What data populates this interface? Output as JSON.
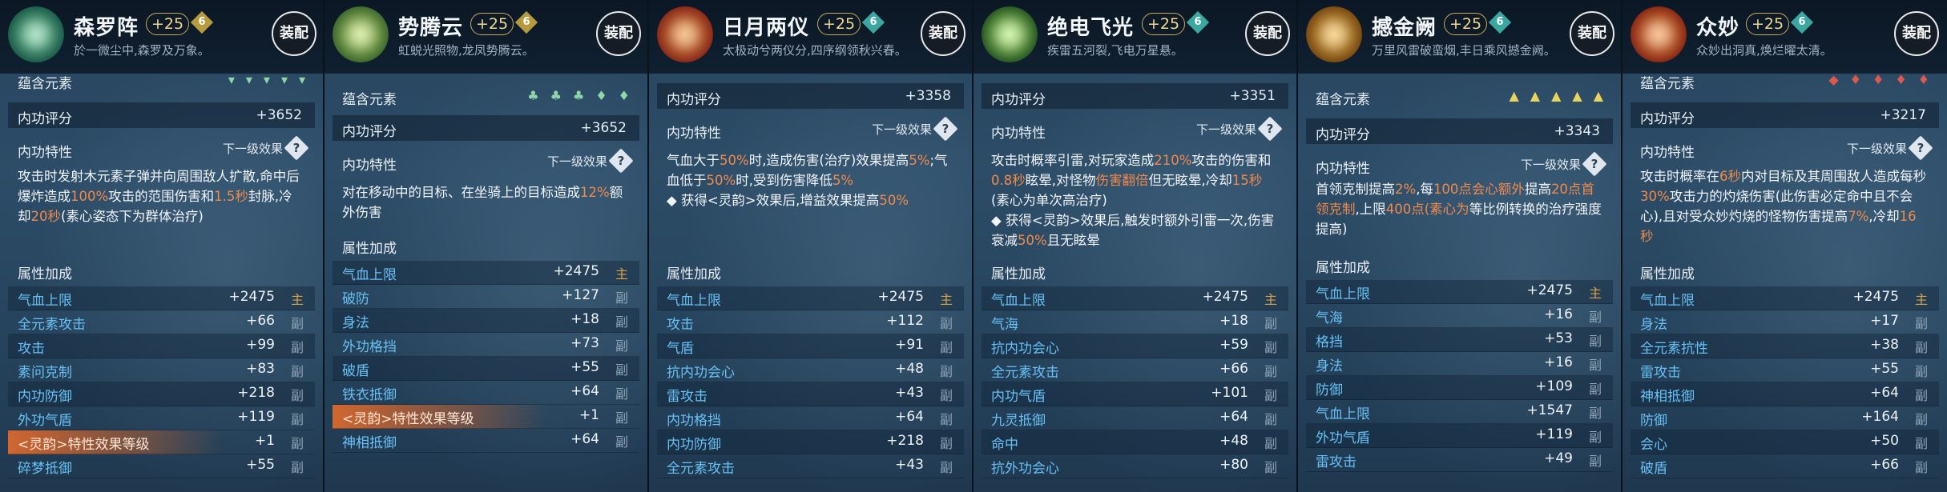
{
  "cards": [
    {
      "title": "森罗阵",
      "plus": "+25",
      "grade": "6",
      "grade_color": "#b79a3e",
      "subtitle": "於一微尘中,森罗及万象。",
      "equip": "装配",
      "emblem_colors": [
        "#1d5e4b",
        "#7fd3a4"
      ],
      "element_label": "蕴含元素",
      "elements": [
        "▾",
        "▾",
        "▾",
        "▾",
        "▾"
      ],
      "element_color": "#8fd7a6",
      "score_label": "内功评分",
      "score": "+3652",
      "trait_label": "内功特性",
      "next_label": "下一级效果",
      "desc": "攻击时发射木元素子弹并向周围敌人扩散,命中后爆炸造成100%攻击的范围伤害和1.5秒封脉,冷却20秒(素心姿态下为群体治疗)",
      "attr_label": "属性加成",
      "attributes": [
        {
          "name": "气血上限",
          "value": "+2475",
          "tag": "主"
        },
        {
          "name": "全元素攻击",
          "value": "+66",
          "tag": "副"
        },
        {
          "name": "攻击",
          "value": "+99",
          "tag": "副"
        },
        {
          "name": "素问克制",
          "value": "+83",
          "tag": "副"
        },
        {
          "name": "内功防御",
          "value": "+218",
          "tag": "副"
        },
        {
          "name": "外功气盾",
          "value": "+119",
          "tag": "副"
        },
        {
          "name": "<灵韵>特性效果等级",
          "value": "+1",
          "tag": "副",
          "highlight": true
        },
        {
          "name": "碎梦抵御",
          "value": "+55",
          "tag": "副"
        }
      ]
    },
    {
      "title": "势腾云",
      "plus": "+25",
      "grade": "6",
      "grade_color": "#b79a3e",
      "subtitle": "虹蜕光照物,龙凤势腾云。",
      "equip": "装配",
      "emblem_colors": [
        "#3f6b2e",
        "#c8e27a"
      ],
      "element_label": "蕴含元素",
      "elements": [
        "♣",
        "♣",
        "♣",
        "♦",
        "♦"
      ],
      "element_color": "#8fd7a6",
      "score_label": "内功评分",
      "score": "+3652",
      "trait_label": "内功特性",
      "next_label": "下一级效果",
      "desc": "对在移动中的目标、在坐骑上的目标造成12%额外伤害",
      "attr_label": "属性加成",
      "attributes": [
        {
          "name": "气血上限",
          "value": "+2475",
          "tag": "主"
        },
        {
          "name": "破防",
          "value": "+127",
          "tag": "副"
        },
        {
          "name": "身法",
          "value": "+18",
          "tag": "副"
        },
        {
          "name": "外功格挡",
          "value": "+73",
          "tag": "副"
        },
        {
          "name": "破盾",
          "value": "+55",
          "tag": "副"
        },
        {
          "name": "铁衣抵御",
          "value": "+64",
          "tag": "副"
        },
        {
          "name": "<灵韵>特性效果等级",
          "value": "+1",
          "tag": "副",
          "highlight": true
        },
        {
          "name": "神相抵御",
          "value": "+64",
          "tag": "副"
        }
      ]
    },
    {
      "title": "日月两仪",
      "plus": "+25",
      "grade": "6",
      "grade_color": "#3aa7a0",
      "subtitle": "太极动兮两仪分,四序纲领秋兴春。",
      "equip": "装配",
      "emblem_colors": [
        "#8a2a1a",
        "#f0a450"
      ],
      "score_label": "内功评分",
      "score": "+3358",
      "trait_label": "内功特性",
      "next_label": "下一级效果",
      "desc": "气血大于50%时,造成伤害(治疗)效果提高5%;气血低于50%时,受到伤害降低5%",
      "bullet": "◆ 获得<灵韵>效果后,增益效果提高50%",
      "attr_label": "属性加成",
      "attributes": [
        {
          "name": "气血上限",
          "value": "+2475",
          "tag": "主"
        },
        {
          "name": "攻击",
          "value": "+112",
          "tag": "副"
        },
        {
          "name": "气盾",
          "value": "+91",
          "tag": "副"
        },
        {
          "name": "抗内功会心",
          "value": "+48",
          "tag": "副"
        },
        {
          "name": "雷攻击",
          "value": "+43",
          "tag": "副"
        },
        {
          "name": "内功格挡",
          "value": "+64",
          "tag": "副"
        },
        {
          "name": "内功防御",
          "value": "+218",
          "tag": "副"
        },
        {
          "name": "全元素攻击",
          "value": "+43",
          "tag": "副"
        }
      ]
    },
    {
      "title": "绝电飞光",
      "plus": "+25",
      "grade": "6",
      "grade_color": "#3aa7a0",
      "subtitle": "疾雷五河裂,飞电万星悬。",
      "equip": "装配",
      "emblem_colors": [
        "#2a5a24",
        "#b9f07a"
      ],
      "score_label": "内功评分",
      "score": "+3351",
      "trait_label": "内功特性",
      "next_label": "下一级效果",
      "desc": "攻击时概率引雷,对玩家造成210%攻击的伤害和0.8秒眩晕,对怪物伤害翻倍但无眩晕,冷却15秒(素心为单次高治疗)",
      "bullet": "◆ 获得<灵韵>效果后,触发时额外引雷一次,伤害衰减50%且无眩晕",
      "attr_label": "属性加成",
      "attributes": [
        {
          "name": "气血上限",
          "value": "+2475",
          "tag": "主"
        },
        {
          "name": "气海",
          "value": "+18",
          "tag": "副"
        },
        {
          "name": "抗内功会心",
          "value": "+59",
          "tag": "副"
        },
        {
          "name": "全元素攻击",
          "value": "+66",
          "tag": "副"
        },
        {
          "name": "内功气盾",
          "value": "+101",
          "tag": "副"
        },
        {
          "name": "九灵抵御",
          "value": "+64",
          "tag": "副"
        },
        {
          "name": "命中",
          "value": "+48",
          "tag": "副"
        },
        {
          "name": "抗外功会心",
          "value": "+80",
          "tag": "副"
        }
      ]
    },
    {
      "title": "撼金阙",
      "plus": "+25",
      "grade": "6",
      "grade_color": "#3aa7a0",
      "subtitle": "万里风雷破蛮烟,丰日乘风撼金阙。",
      "equip": "装配",
      "emblem_colors": [
        "#7a4a12",
        "#f3c25a"
      ],
      "element_label": "蕴含元素",
      "elements": [
        "▲",
        "▲",
        "▲",
        "▲",
        "▲"
      ],
      "element_color": "#e8d45a",
      "score_label": "内功评分",
      "score": "+3343",
      "trait_label": "内功特性",
      "next_label": "下一级效果",
      "desc": "首领克制提高2%,每100点会心额外提高20点首领克制,上限400点(素心为等比例转换的治疗强度提高)",
      "attr_label": "属性加成",
      "attributes": [
        {
          "name": "气血上限",
          "value": "+2475",
          "tag": "主"
        },
        {
          "name": "气海",
          "value": "+16",
          "tag": "副"
        },
        {
          "name": "格挡",
          "value": "+53",
          "tag": "副"
        },
        {
          "name": "身法",
          "value": "+16",
          "tag": "副"
        },
        {
          "name": "防御",
          "value": "+109",
          "tag": "副"
        },
        {
          "name": "气血上限",
          "value": "+1547",
          "tag": "副"
        },
        {
          "name": "外功气盾",
          "value": "+119",
          "tag": "副"
        },
        {
          "name": "雷攻击",
          "value": "+49",
          "tag": "副"
        }
      ]
    },
    {
      "title": "众妙",
      "plus": "+25",
      "grade": "6",
      "grade_color": "#3aa7a0",
      "subtitle": "众妙出洞真,焕烂曜太清。",
      "equip": "装配",
      "emblem_colors": [
        "#8a2a14",
        "#f6a35a"
      ],
      "element_label": "蕴含元素",
      "elements": [
        "◆",
        "♦",
        "♦",
        "♦",
        "♦"
      ],
      "element_color": "#e0584a",
      "score_label": "内功评分",
      "score": "+3217",
      "trait_label": "内功特性",
      "next_label": "下一级效果",
      "desc": "攻击时概率在6秒内对目标及其周围敌人造成每秒30%攻击力的灼烧伤害(此伤害必定命中且不会心),且对受众妙灼烧的怪物伤害提高7%,冷却16秒",
      "attr_label": "属性加成",
      "attributes": [
        {
          "name": "气血上限",
          "value": "+2475",
          "tag": "主"
        },
        {
          "name": "身法",
          "value": "+17",
          "tag": "副"
        },
        {
          "name": "全元素抗性",
          "value": "+38",
          "tag": "副"
        },
        {
          "name": "雷攻击",
          "value": "+55",
          "tag": "副"
        },
        {
          "name": "神相抵御",
          "value": "+64",
          "tag": "副"
        },
        {
          "name": "防御",
          "value": "+164",
          "tag": "副"
        },
        {
          "name": "会心",
          "value": "+50",
          "tag": "副"
        },
        {
          "name": "破盾",
          "value": "+66",
          "tag": "副"
        }
      ]
    }
  ]
}
